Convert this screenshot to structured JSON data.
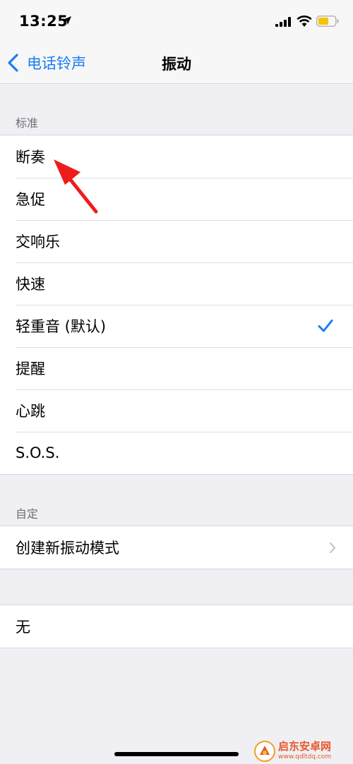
{
  "status_bar": {
    "time": "13:25"
  },
  "nav": {
    "back_label": "电话铃声",
    "title": "振动"
  },
  "sections": {
    "standard": {
      "header": "标准",
      "items": [
        {
          "label": "断奏"
        },
        {
          "label": "急促"
        },
        {
          "label": "交响乐"
        },
        {
          "label": "快速"
        },
        {
          "label": "轻重音 (默认)",
          "selected": true
        },
        {
          "label": "提醒"
        },
        {
          "label": "心跳"
        },
        {
          "label": "S.O.S."
        }
      ]
    },
    "custom": {
      "header": "自定",
      "create_label": "创建新振动模式"
    },
    "none": {
      "label": "无"
    }
  },
  "colors": {
    "accent": "#1a7cf5",
    "annotation": "#ee1c1c",
    "battery": "#f5c400",
    "background": "#efeff4"
  },
  "icons": {
    "back": "chevron-left-icon",
    "selected": "checkmark-icon",
    "disclosure": "chevron-right-icon"
  },
  "watermark": {
    "name": "启东安卓网",
    "url": "www.qdltdq.com"
  }
}
